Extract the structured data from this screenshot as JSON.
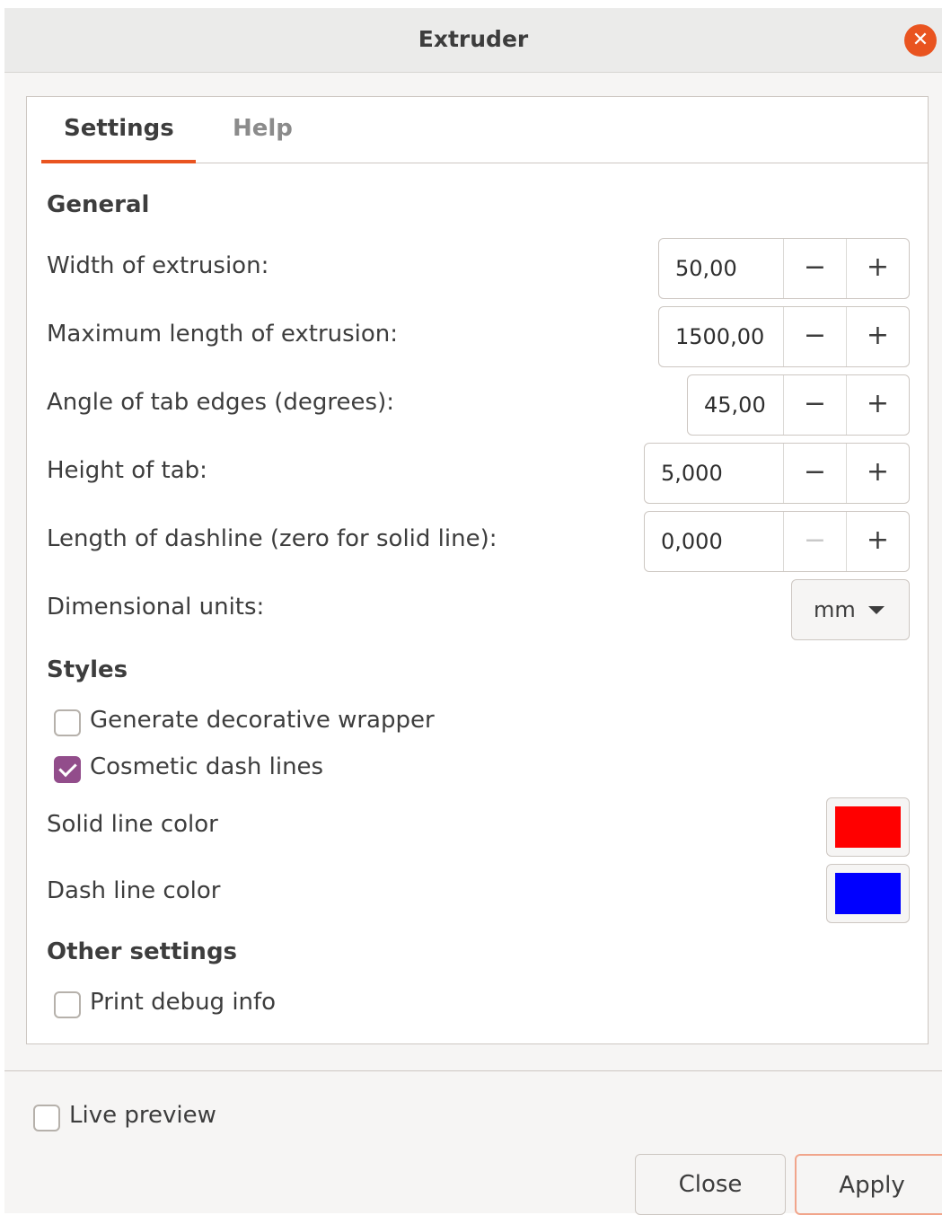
{
  "window": {
    "title": "Extruder"
  },
  "tabs": [
    "Settings",
    "Help"
  ],
  "general": {
    "heading": "General",
    "fields": [
      {
        "label": "Width of extrusion:",
        "value": "50,00",
        "minus": "−",
        "plus": "+"
      },
      {
        "label": "Maximum length of extrusion:",
        "value": "1500,00",
        "minus": "−",
        "plus": "+"
      },
      {
        "label": "Angle of tab edges (degrees):",
        "value": "45,00",
        "minus": "−",
        "plus": "+"
      },
      {
        "label": "Height of tab:",
        "value": "5,000",
        "minus": "−",
        "plus": "+"
      },
      {
        "label": "Length of dashline (zero for solid line):",
        "value": "0,000",
        "minus": "−",
        "plus": "+"
      }
    ],
    "units_label": "Dimensional units:",
    "units_value": "mm"
  },
  "styles": {
    "heading": "Styles",
    "generate_wrapper": {
      "label": "Generate decorative wrapper",
      "checked": false
    },
    "cosmetic_dash": {
      "label": "Cosmetic dash lines",
      "checked": true
    },
    "solid_color": {
      "label": "Solid line color",
      "color": "#ff0000"
    },
    "dash_color": {
      "label": "Dash line color",
      "color": "#0000ff"
    }
  },
  "other": {
    "heading": "Other settings",
    "debug": {
      "label": "Print debug info",
      "checked": false
    }
  },
  "footer": {
    "live_preview": {
      "label": "Live preview",
      "checked": false
    },
    "close_label": "Close",
    "apply_label": "Apply"
  }
}
